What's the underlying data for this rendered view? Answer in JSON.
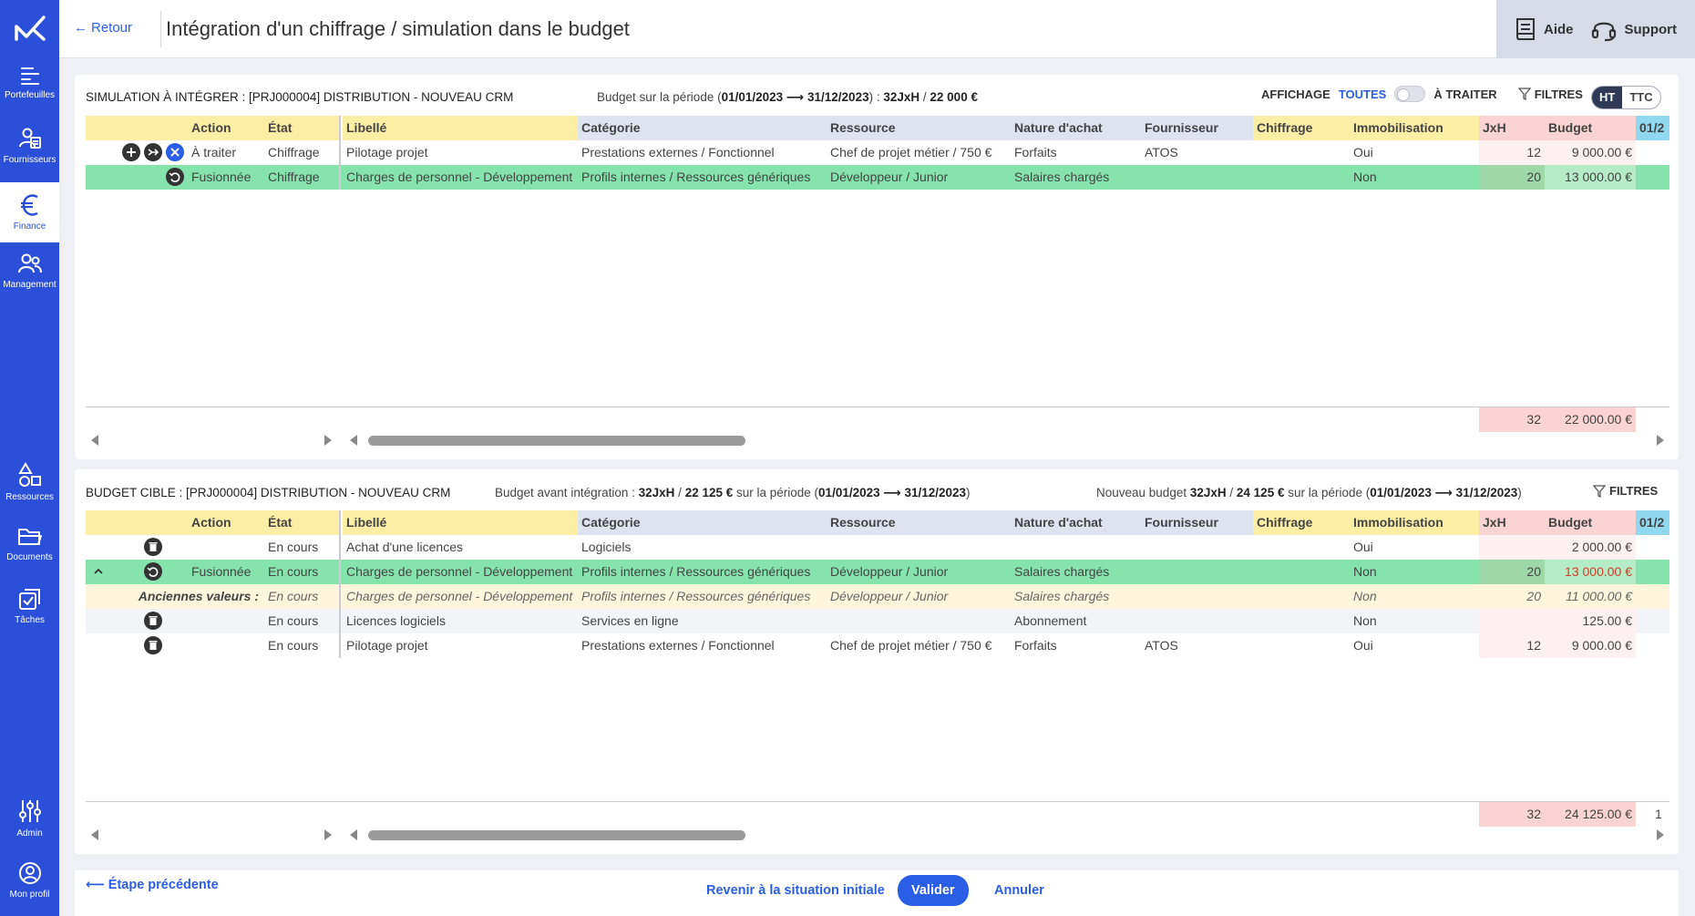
{
  "nav": {
    "items": [
      {
        "label": "Portefeuilles",
        "icon": "portfolio-icon"
      },
      {
        "label": "Fournisseurs",
        "icon": "suppliers-icon"
      },
      {
        "label": "Finance",
        "icon": "euro-icon"
      },
      {
        "label": "Management",
        "icon": "people-icon"
      },
      {
        "label": "Ressources",
        "icon": "shapes-icon"
      },
      {
        "label": "Documents",
        "icon": "folder-icon"
      },
      {
        "label": "Tâches",
        "icon": "tasks-icon"
      },
      {
        "label": "Admin",
        "icon": "sliders-icon"
      },
      {
        "label": "Mon profil",
        "icon": "profile-icon"
      }
    ]
  },
  "header": {
    "back": "Retour",
    "title": "Intégration d'un chiffrage / simulation dans le budget",
    "help": "Aide",
    "support": "Support"
  },
  "sim": {
    "title": "SIMULATION À INTÉGRER : [PRJ000004] DISTRIBUTION - NOUVEAU CRM",
    "budget_prefix": "Budget sur la période (",
    "budget_period": "01/01/2023 ⟶ 31/12/2023",
    "budget_mid": ") : ",
    "budget_val": "32JxH",
    "budget_sep": " / ",
    "budget_amount": "22 000 €",
    "affichage": "AFFICHAGE",
    "toutes": "TOUTES",
    "a_traiter": "À TRAITER",
    "filtres": "FILTRES",
    "ht": "HT",
    "ttc": "TTC",
    "rows": [
      {
        "action": "À traiter",
        "etat": "Chiffrage",
        "libelle": "Pilotage projet",
        "categorie": "Prestations externes / Fonctionnel",
        "ressource": "Chef de projet métier / 750 €",
        "nature": "Forfaits",
        "fournisseur": "ATOS",
        "chiffrage": "",
        "immo": "Oui",
        "jxh": "12",
        "budget": "9 000.00 €"
      },
      {
        "action": "Fusionnée",
        "etat": "Chiffrage",
        "libelle": "Charges de personnel - Développement",
        "categorie": "Profils internes / Ressources génériques",
        "ressource": "Développeur / Junior",
        "nature": "Salaires chargés",
        "fournisseur": "",
        "chiffrage": "",
        "immo": "Non",
        "jxh": "20",
        "budget": "13 000.00 €"
      }
    ],
    "total_jxh": "32",
    "total_budget": "22 000.00 €"
  },
  "columns": {
    "action": "Action",
    "etat": "État",
    "libelle": "Libellé",
    "categorie": "Catégorie",
    "ressource": "Ressource",
    "nature": "Nature d'achat",
    "fournisseur": "Fournisseur",
    "chiffrage": "Chiffrage",
    "immo": "Immobilisation",
    "jxh": "JxH",
    "budget": "Budget",
    "date": "01/2"
  },
  "cible": {
    "title": "BUDGET CIBLE : [PRJ000004] DISTRIBUTION - NOUVEAU CRM",
    "before_prefix": "Budget avant intégration : ",
    "before_val": "32JxH",
    "before_sep": " / ",
    "before_amount": "22 125 €",
    "before_mid": " sur la période (",
    "before_period": "01/01/2023 ⟶ 31/12/2023",
    "before_end": ")",
    "new_prefix": "Nouveau budget ",
    "new_val": "32JxH",
    "new_sep": " / ",
    "new_amount": "24 125 €",
    "new_mid": " sur la période (",
    "new_period": "01/01/2023 ⟶ 31/12/2023",
    "new_end": ")",
    "filtres": "FILTRES",
    "rows": [
      {
        "action": "",
        "etat": "En cours",
        "libelle": "Achat d'une licences",
        "categorie": "Logiciels",
        "ressource": "",
        "nature": "",
        "fournisseur": "",
        "immo": "Oui",
        "jxh": "",
        "budget": "2 000.00 €"
      },
      {
        "action": "Fusionnée",
        "etat": "En cours",
        "libelle": "Charges de personnel - Développement",
        "categorie": "Profils internes / Ressources génériques",
        "ressource": "Développeur / Junior",
        "nature": "Salaires chargés",
        "fournisseur": "",
        "immo": "Non",
        "jxh": "20",
        "budget": "13 000.00 €"
      },
      {
        "action": "Anciennes valeurs :",
        "etat": "En cours",
        "libelle": "Charges de personnel - Développement",
        "categorie": "Profils internes / Ressources génériques",
        "ressource": "Développeur / Junior",
        "nature": "Salaires chargés",
        "fournisseur": "",
        "immo": "Non",
        "jxh": "20",
        "budget": "11 000.00 €"
      },
      {
        "action": "",
        "etat": "En cours",
        "libelle": "Licences logiciels",
        "categorie": "Services en ligne",
        "ressource": "",
        "nature": "Abonnement",
        "fournisseur": "",
        "immo": "Non",
        "jxh": "",
        "budget": "125.00 €"
      },
      {
        "action": "",
        "etat": "En cours",
        "libelle": "Pilotage projet",
        "categorie": "Prestations externes / Fonctionnel",
        "ressource": "Chef de projet métier / 750 €",
        "nature": "Forfaits",
        "fournisseur": "ATOS",
        "immo": "Oui",
        "jxh": "12",
        "budget": "9 000.00 €"
      }
    ],
    "total_jxh": "32",
    "total_budget": "24 125.00 €",
    "total_more": "1"
  },
  "footer": {
    "prev": "Étape précédente",
    "reset": "Revenir à la situation initiale",
    "validate": "Valider",
    "cancel": "Annuler"
  },
  "colors": {
    "accent": "#2b5ee6",
    "sidebar": "#2b4fd8",
    "yellow": "#fdeea5",
    "lavender": "#dfe2ef",
    "pink": "#fad3d3",
    "green": "#86e3ab",
    "cream": "#fdf6dc",
    "cyan": "#8fd8ef"
  }
}
